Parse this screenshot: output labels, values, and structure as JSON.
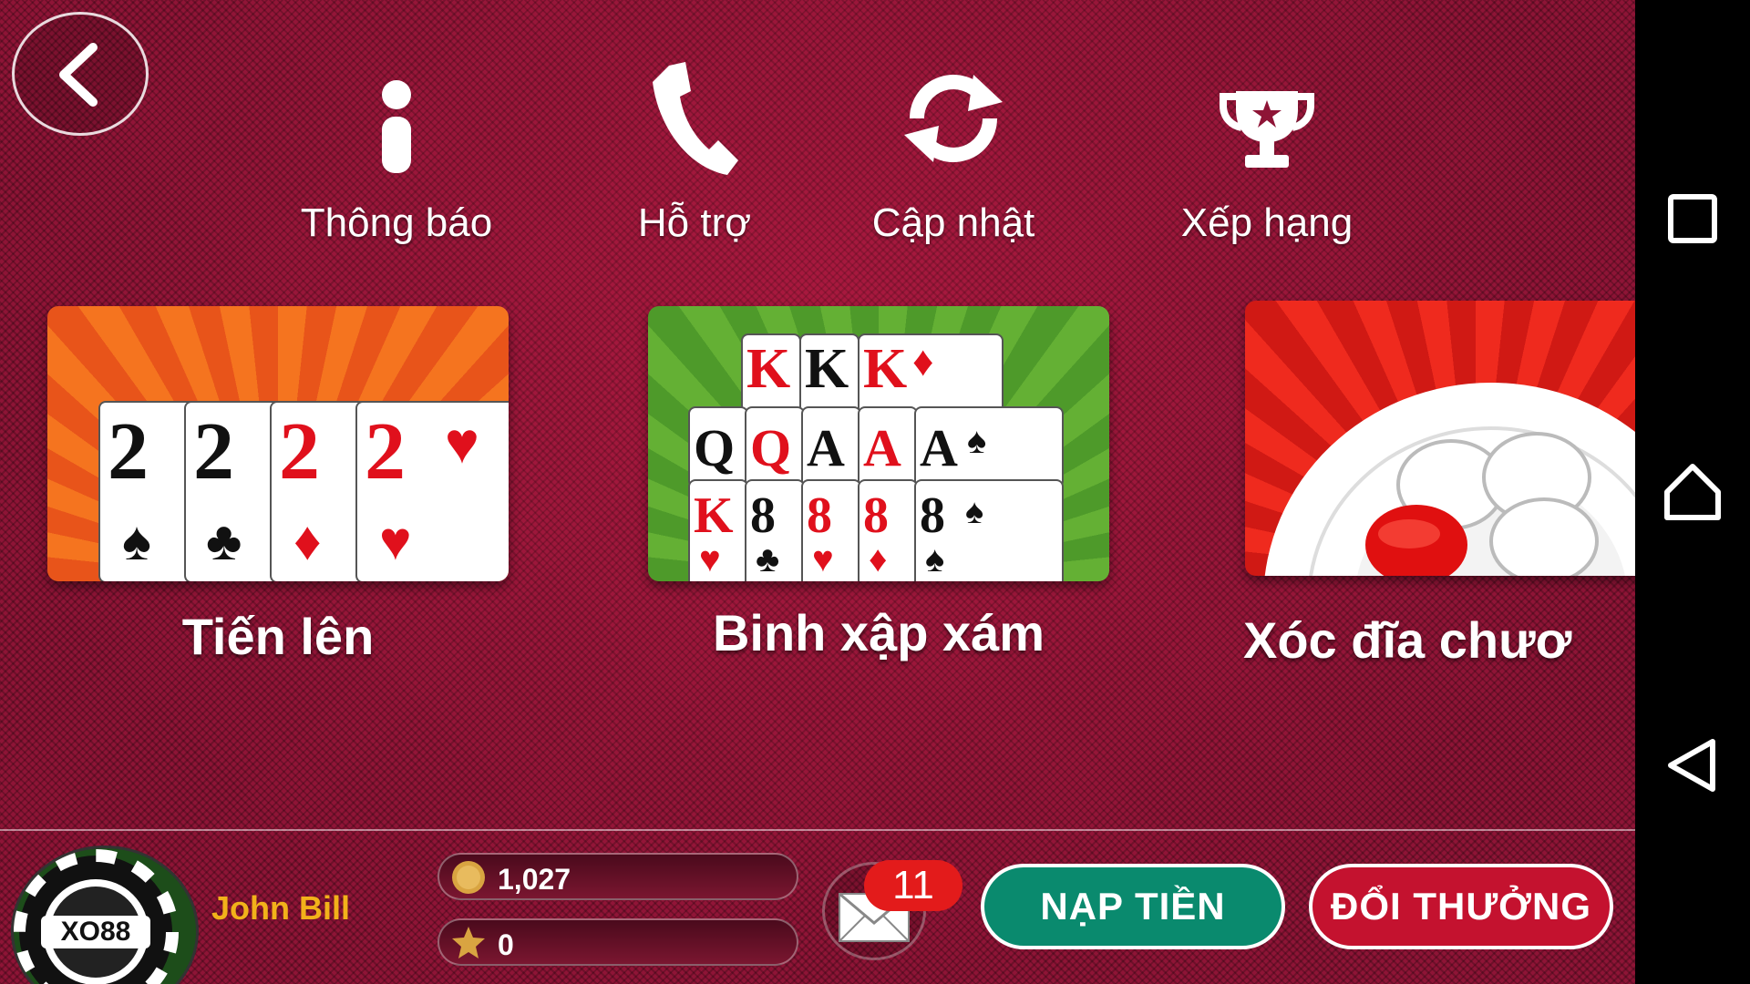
{
  "menu": {
    "items": [
      {
        "label": "Thông báo",
        "icon": "info-icon"
      },
      {
        "label": "Hỗ trợ",
        "icon": "phone-icon"
      },
      {
        "label": "Cập nhật",
        "icon": "refresh-icon"
      },
      {
        "label": "Xếp hạng",
        "icon": "trophy-icon"
      }
    ]
  },
  "games": [
    {
      "label": "Tiến lên",
      "accent": "#f26a1b"
    },
    {
      "label": "Binh xập xám",
      "accent": "#5ea832"
    },
    {
      "label": "Xóc đĩa chươ",
      "accent": "#e0201c"
    }
  ],
  "cards": {
    "tien_len": [
      "2",
      "2",
      "2",
      "2"
    ],
    "binh_row1": [
      "K",
      "K",
      "K"
    ],
    "binh_row2": [
      "Q",
      "Q",
      "A",
      "A",
      "A"
    ],
    "binh_row3": [
      "K",
      "8",
      "8",
      "8",
      "8"
    ],
    "suits": {
      "spade": "♠",
      "club": "♣",
      "diamond": "♦",
      "heart": "♥"
    }
  },
  "user": {
    "name": "John Bill",
    "avatar_text": "XO88",
    "coins": "1,027",
    "stars": "0"
  },
  "mail": {
    "count": "11"
  },
  "buttons": {
    "deposit": "NẠP TIỀN",
    "redeem": "ĐỔI THƯỞNG"
  },
  "colors": {
    "background": "#8e1436",
    "deposit": "#0a8a6e",
    "redeem": "#c4122f",
    "username": "#f2b21a"
  }
}
